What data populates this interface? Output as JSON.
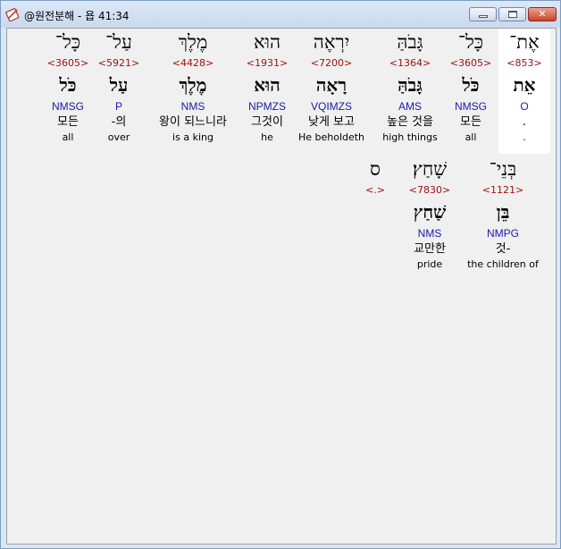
{
  "window": {
    "title": "@원전분해 - 욥 41:34",
    "controls": {
      "minimize": "minimize",
      "maximize": "maximize",
      "close": "✕"
    }
  },
  "rows": [
    [
      {
        "heb": "אֶת־",
        "strong": "<853>",
        "lemma": "אֵת",
        "morph": "O",
        "ko": ".",
        "en": "."
      },
      {
        "heb": "כָּל־",
        "strong": "<3605>",
        "lemma": "כֹּל",
        "morph": "NMSG",
        "ko": "모든",
        "en": "all"
      },
      {
        "heb": "גָּבֹהַּ",
        "strong": "<1364>",
        "lemma": "גָּבֹהַּ",
        "morph": "AMS",
        "ko": "높은 것을",
        "en": "high things"
      },
      {
        "heb": "יִרְאֶה",
        "strong": "<7200>",
        "lemma": "רָאָה",
        "morph": "VQIMZS",
        "ko": "낮게 보고",
        "en": "He beholdeth"
      },
      {
        "heb": "הוּא",
        "strong": "<1931>",
        "lemma": "הוּא",
        "morph": "NPMZS",
        "ko": "그것이",
        "en": "he"
      },
      {
        "heb": "מֶלֶךְ",
        "strong": "<4428>",
        "lemma": "מֶלֶךְ",
        "morph": "NMS",
        "ko": "왕이 되느니라",
        "en": "is a king"
      },
      {
        "heb": "עַל־",
        "strong": "<5921>",
        "lemma": "עַל",
        "morph": "P",
        "ko": "-의",
        "en": "over"
      },
      {
        "heb": "כָּל־",
        "strong": "<3605>",
        "lemma": "כֹּל",
        "morph": "NMSG",
        "ko": "모든",
        "en": "all"
      }
    ],
    [
      {
        "heb": "בְּנֵי־",
        "strong": "<1121>",
        "lemma": "בֵּן",
        "morph": "NMPG",
        "ko": "것-",
        "en": "the children of"
      },
      {
        "heb": "שָׁחַץ׃",
        "strong": "<7830>",
        "lemma": "שַׁחַץ",
        "morph": "NMS",
        "ko": "교만한",
        "en": "pride"
      },
      {
        "heb": "ס",
        "strong": "<.>",
        "lemma": "",
        "morph": "",
        "ko": "",
        "en": ""
      }
    ]
  ]
}
